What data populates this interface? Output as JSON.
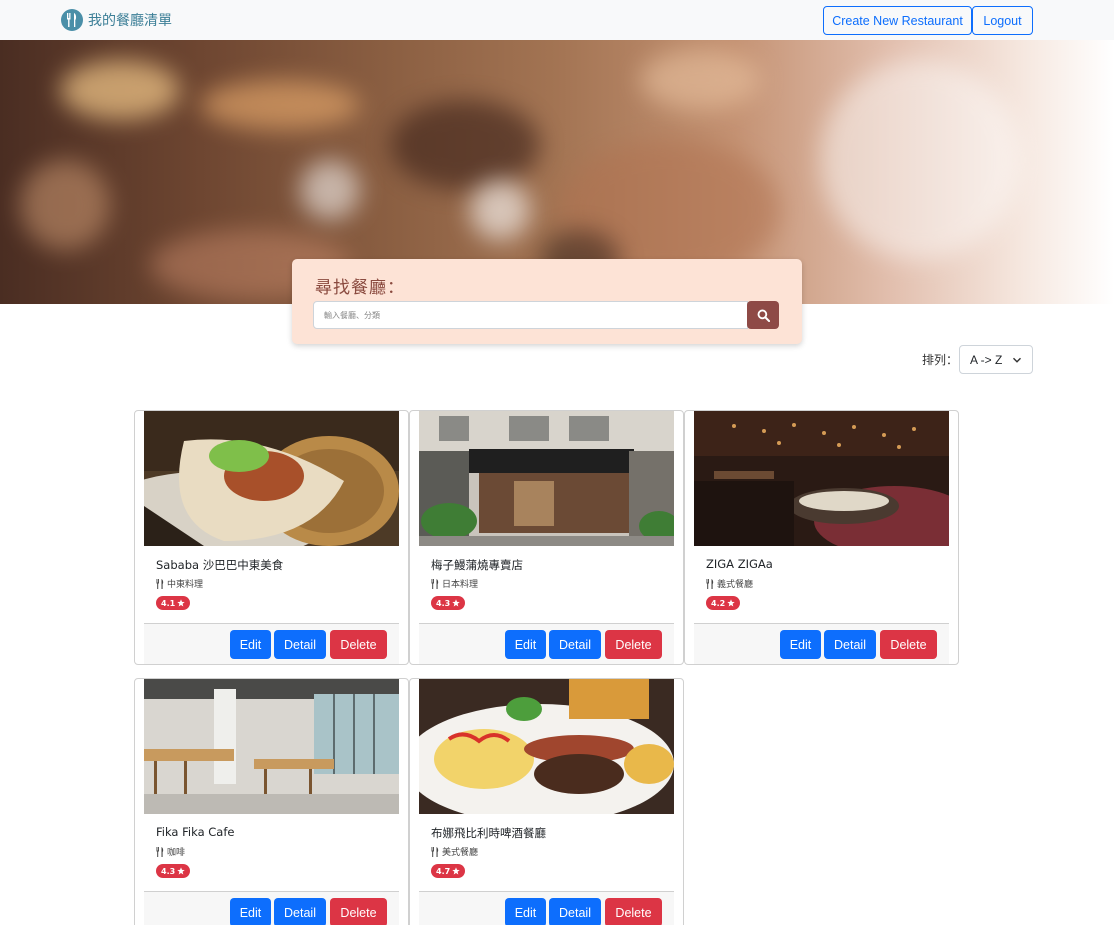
{
  "nav": {
    "brand": "我的餐廳清單",
    "create_label": "Create New Restaurant",
    "logout_label": "Logout"
  },
  "search": {
    "title": "尋找餐廳：",
    "placeholder": "輸入餐廳、分類"
  },
  "sort": {
    "label": "排列：",
    "value": "A -> Z"
  },
  "card_buttons": {
    "edit": "Edit",
    "detail": "Detail",
    "delete": "Delete"
  },
  "restaurants": [
    {
      "name": "Sababa 沙巴巴中東美食",
      "category": "中東料理",
      "rating": "4.1"
    },
    {
      "name": "梅子鰻蒲燒專賣店",
      "category": "日本料理",
      "rating": "4.3"
    },
    {
      "name": "ZIGA ZIGAa",
      "category": "義式餐廳",
      "rating": "4.2"
    },
    {
      "name": "Fika Fika Cafe",
      "category": "咖啡",
      "rating": "4.3"
    },
    {
      "name": "布娜飛比利時啤酒餐廳",
      "category": "美式餐廳",
      "rating": "4.7"
    }
  ],
  "colors": {
    "primary": "#0d6efd",
    "danger": "#dc3545",
    "search_panel": "#fde3d6",
    "search_button": "#8e4a46"
  }
}
